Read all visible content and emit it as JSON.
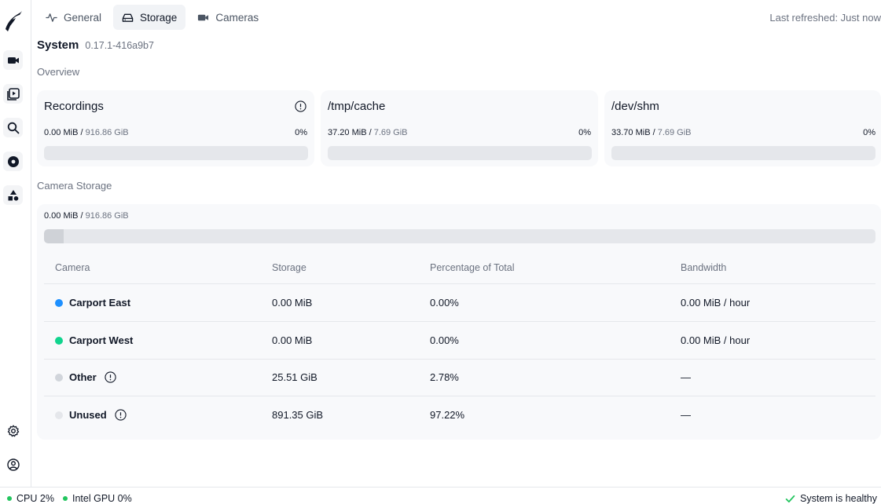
{
  "tabs": [
    {
      "label": "General",
      "icon": "activity-icon"
    },
    {
      "label": "Storage",
      "icon": "drive-icon"
    },
    {
      "label": "Cameras",
      "icon": "video-icon"
    }
  ],
  "last_refreshed": "Last refreshed: Just now",
  "system": {
    "title": "System",
    "version": "0.17.1-416a9b7"
  },
  "overview": {
    "label": "Overview",
    "cards": [
      {
        "title": "Recordings",
        "used": "0.00 MiB",
        "total": "916.86 GiB",
        "percent": "0%",
        "fill_fraction": 0
      },
      {
        "title": "/tmp/cache",
        "used": "37.20 MiB",
        "total": "7.69 GiB",
        "percent": "0%",
        "fill_fraction": 0
      },
      {
        "title": "/dev/shm",
        "used": "33.70 MiB",
        "total": "7.69 GiB",
        "percent": "0%",
        "fill_fraction": 0
      }
    ]
  },
  "camera_storage": {
    "label": "Camera Storage",
    "used": "0.00 MiB",
    "total": "916.86 GiB",
    "fill_fraction": 0.024,
    "columns": [
      "Camera",
      "Storage",
      "Percentage of Total",
      "Bandwidth"
    ],
    "rows": [
      {
        "name": "Carport East",
        "storage": "0.00 MiB",
        "percent": "0.00%",
        "bandwidth": "0.00 MiB / hour",
        "color": "#1e90ff"
      },
      {
        "name": "Carport West",
        "storage": "0.00 MiB",
        "percent": "0.00%",
        "bandwidth": "0.00 MiB / hour",
        "color": "#10d48e"
      },
      {
        "name": "Other",
        "storage": "25.51 GiB",
        "percent": "2.78%",
        "bandwidth": "—",
        "color": "#d1d5db"
      },
      {
        "name": "Unused",
        "storage": "891.35 GiB",
        "percent": "97.22%",
        "bandwidth": "—",
        "color": "#e5e7eb"
      }
    ]
  },
  "footer": {
    "cpu": "CPU 2%",
    "gpu": "Intel GPU 0%",
    "status": "System is healthy"
  },
  "colors": {
    "healthy": "#22c55e",
    "accent_bg": "#f1f3f6"
  }
}
